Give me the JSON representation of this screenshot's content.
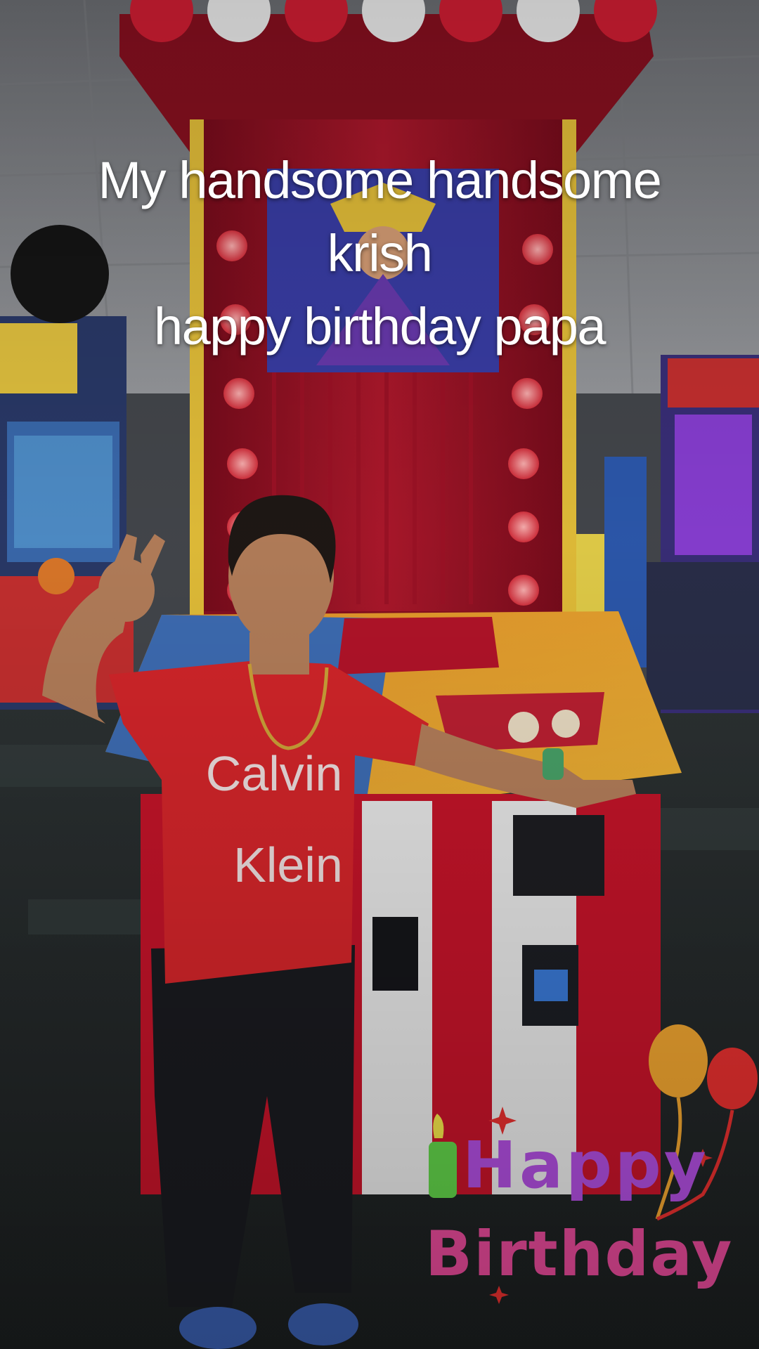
{
  "caption": {
    "line1": "My handsome handsome",
    "line2": "krish",
    "line3": "happy birthday papa"
  },
  "shirt_logo": {
    "line1": "Calvin",
    "line2": "Klein"
  },
  "sticker": {
    "line1": "Happy",
    "line2": "Birthday",
    "icons": [
      "candle-icon",
      "balloon-icon",
      "sparkle-icon"
    ]
  },
  "colors": {
    "arcade_red": "#c8102e",
    "table_yellow": "#f5a623",
    "shirt_red": "#d9262b",
    "carpet": "#2b2f30"
  }
}
